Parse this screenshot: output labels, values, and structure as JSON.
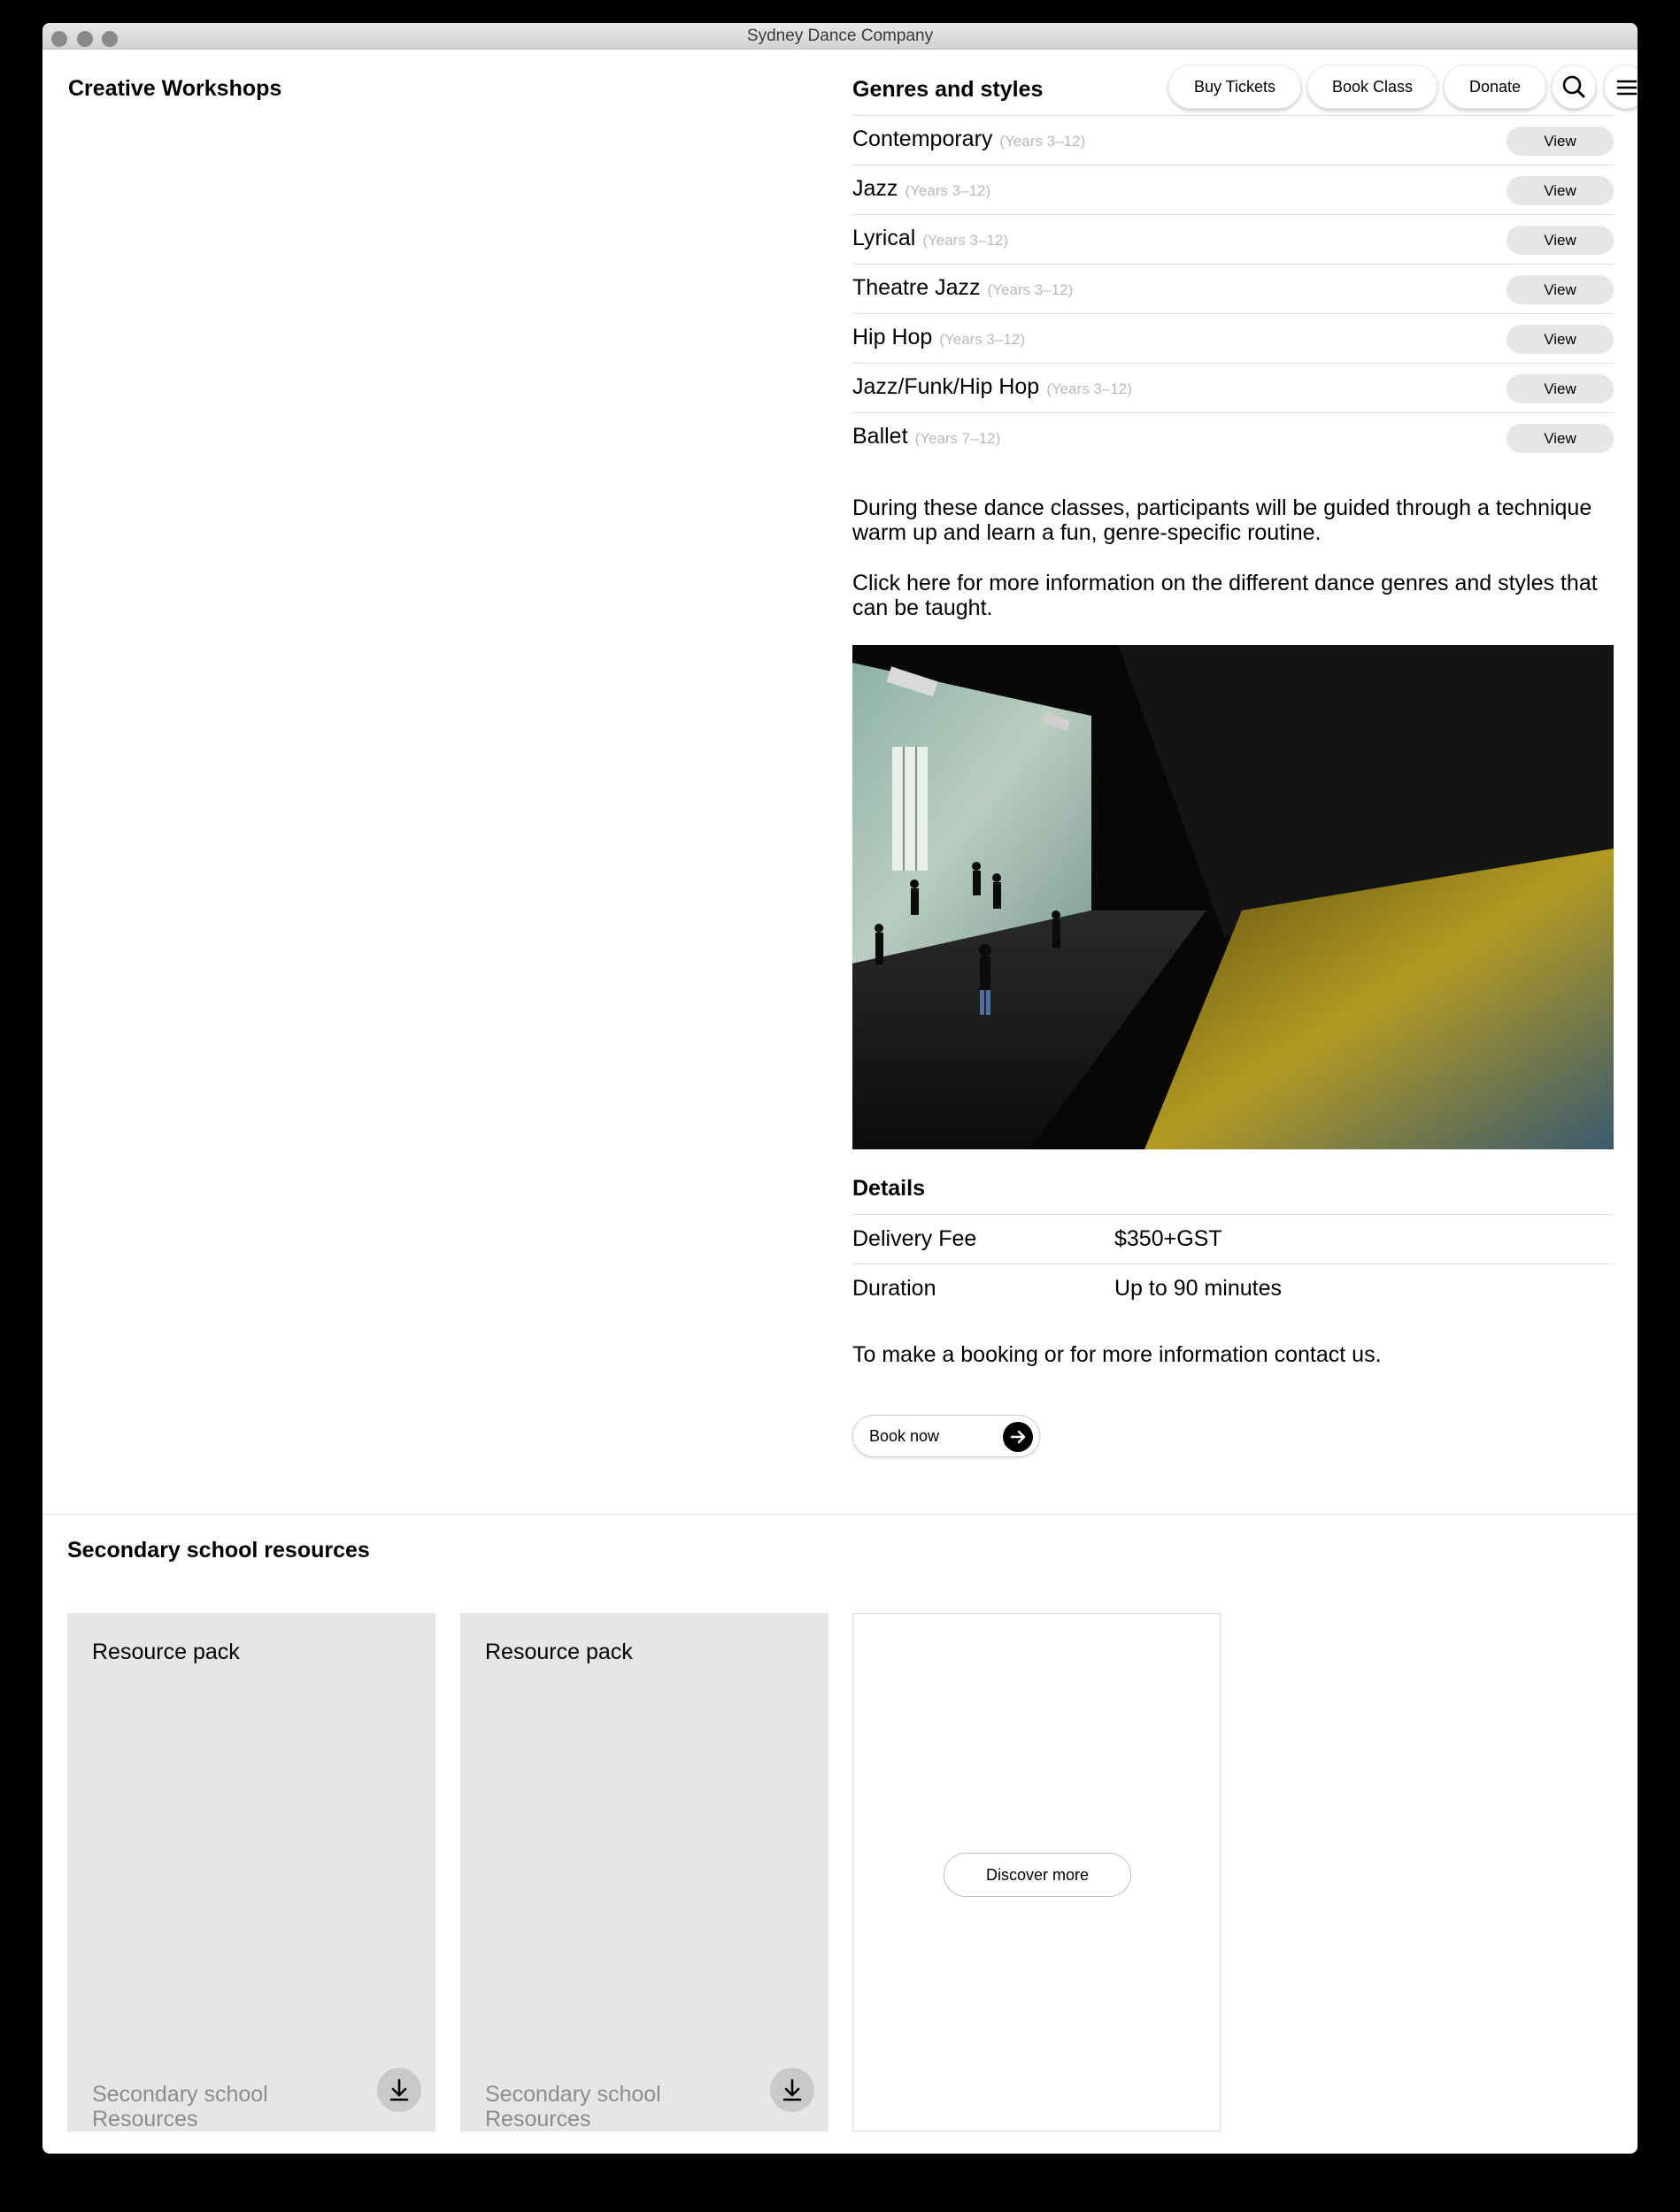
{
  "window": {
    "title": "Sydney Dance Company"
  },
  "left": {
    "title": "Creative Workshops"
  },
  "header": {
    "buy_tickets": "Buy Tickets",
    "book_class": "Book Class",
    "donate": "Donate"
  },
  "genres": {
    "heading": "Genres and styles",
    "items": [
      {
        "name": "Contemporary",
        "years": "(Years 3–12)",
        "action": "View"
      },
      {
        "name": "Jazz",
        "years": "(Years 3–12)",
        "action": "View"
      },
      {
        "name": "Lyrical",
        "years": "(Years 3–12)",
        "action": "View"
      },
      {
        "name": "Theatre Jazz",
        "years": "(Years 3–12)",
        "action": "View"
      },
      {
        "name": "Hip Hop",
        "years": "(Years 3–12)",
        "action": "View"
      },
      {
        "name": "Jazz/Funk/Hip Hop",
        "years": "(Years 3–12)",
        "action": "View"
      },
      {
        "name": "Ballet",
        "years": "(Years 7–12)",
        "action": "View"
      }
    ]
  },
  "description": {
    "p1": "During these dance classes, participants will be guided through a technique warm up and learn a fun, genre-specific routine.",
    "p2": "Click here for more information on the different dance genres and styles that can be taught."
  },
  "details": {
    "heading": "Details",
    "rows": [
      {
        "label": "Delivery Fee",
        "value": "$350+GST"
      },
      {
        "label": "Duration",
        "value": "Up to 90 minutes"
      }
    ],
    "contact_text": "To make a booking or for more information contact us.",
    "book_label": "Book now"
  },
  "resources": {
    "heading": "Secondary school resources",
    "cards": [
      {
        "title": "Resource pack",
        "subtitle": "Secondary school Resources"
      },
      {
        "title": "Resource pack",
        "subtitle": "Secondary school Resources"
      }
    ],
    "discover_label": "Discover more"
  }
}
